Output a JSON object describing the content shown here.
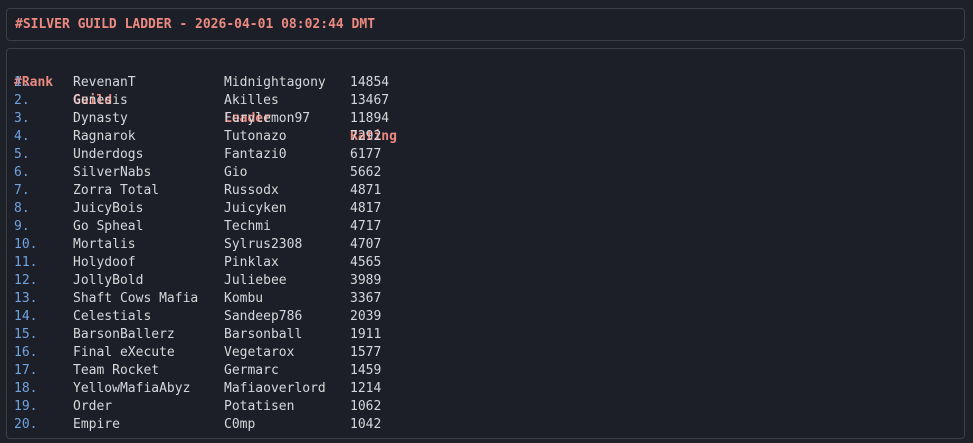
{
  "header": {
    "title": "#SILVER GUILD LADDER - 2026-04-01 08:02:44 DMT"
  },
  "colors": {
    "background": "#1f2128",
    "panel": "#1c1f28",
    "border": "#3b3e46",
    "heading": "#ed8a80",
    "rank": "#6fa3e0",
    "text": "#d6d7da"
  },
  "table": {
    "columns": [
      "#Rank",
      "Guild",
      "Leader",
      "Rating"
    ],
    "rows": [
      [
        "1.",
        "RevenanT",
        "Midnightagony",
        "14854"
      ],
      [
        "2.",
        "Genesis",
        "Akilles",
        "13467"
      ],
      [
        "3.",
        "Dynasty",
        "Furylemon97",
        "11894"
      ],
      [
        "4.",
        "Ragnarok",
        "Tutonazo",
        "7292"
      ],
      [
        "5.",
        "Underdogs",
        "Fantazi0",
        "6177"
      ],
      [
        "6.",
        "SilverNabs",
        "Gio",
        "5662"
      ],
      [
        "7.",
        "Zorra Total",
        "Russodx",
        "4871"
      ],
      [
        "8.",
        "JuicyBois",
        "Juicyken",
        "4817"
      ],
      [
        "9.",
        "Go Spheal",
        "Techmi",
        "4717"
      ],
      [
        "10.",
        "Mortalis",
        "Sylrus2308",
        "4707"
      ],
      [
        "11.",
        "Holydoof",
        "Pinklax",
        "4565"
      ],
      [
        "12.",
        "JollyBold",
        "Juliebee",
        "3989"
      ],
      [
        "13.",
        "Shaft Cows Mafia",
        "Kombu",
        "3367"
      ],
      [
        "14.",
        "Celestials",
        "Sandeep786",
        "2039"
      ],
      [
        "15.",
        "BarsonBallerz",
        "Barsonball",
        "1911"
      ],
      [
        "16.",
        "Final eXecute",
        "Vegetarox",
        "1577"
      ],
      [
        "17.",
        "Team Rocket",
        "Germarc",
        "1459"
      ],
      [
        "18.",
        "YellowMafiaAbyz",
        "Mafiaoverlord",
        "1214"
      ],
      [
        "19.",
        "Order",
        "Potatisen",
        "1062"
      ],
      [
        "20.",
        "Empire",
        "C0mp",
        "1042"
      ]
    ]
  }
}
